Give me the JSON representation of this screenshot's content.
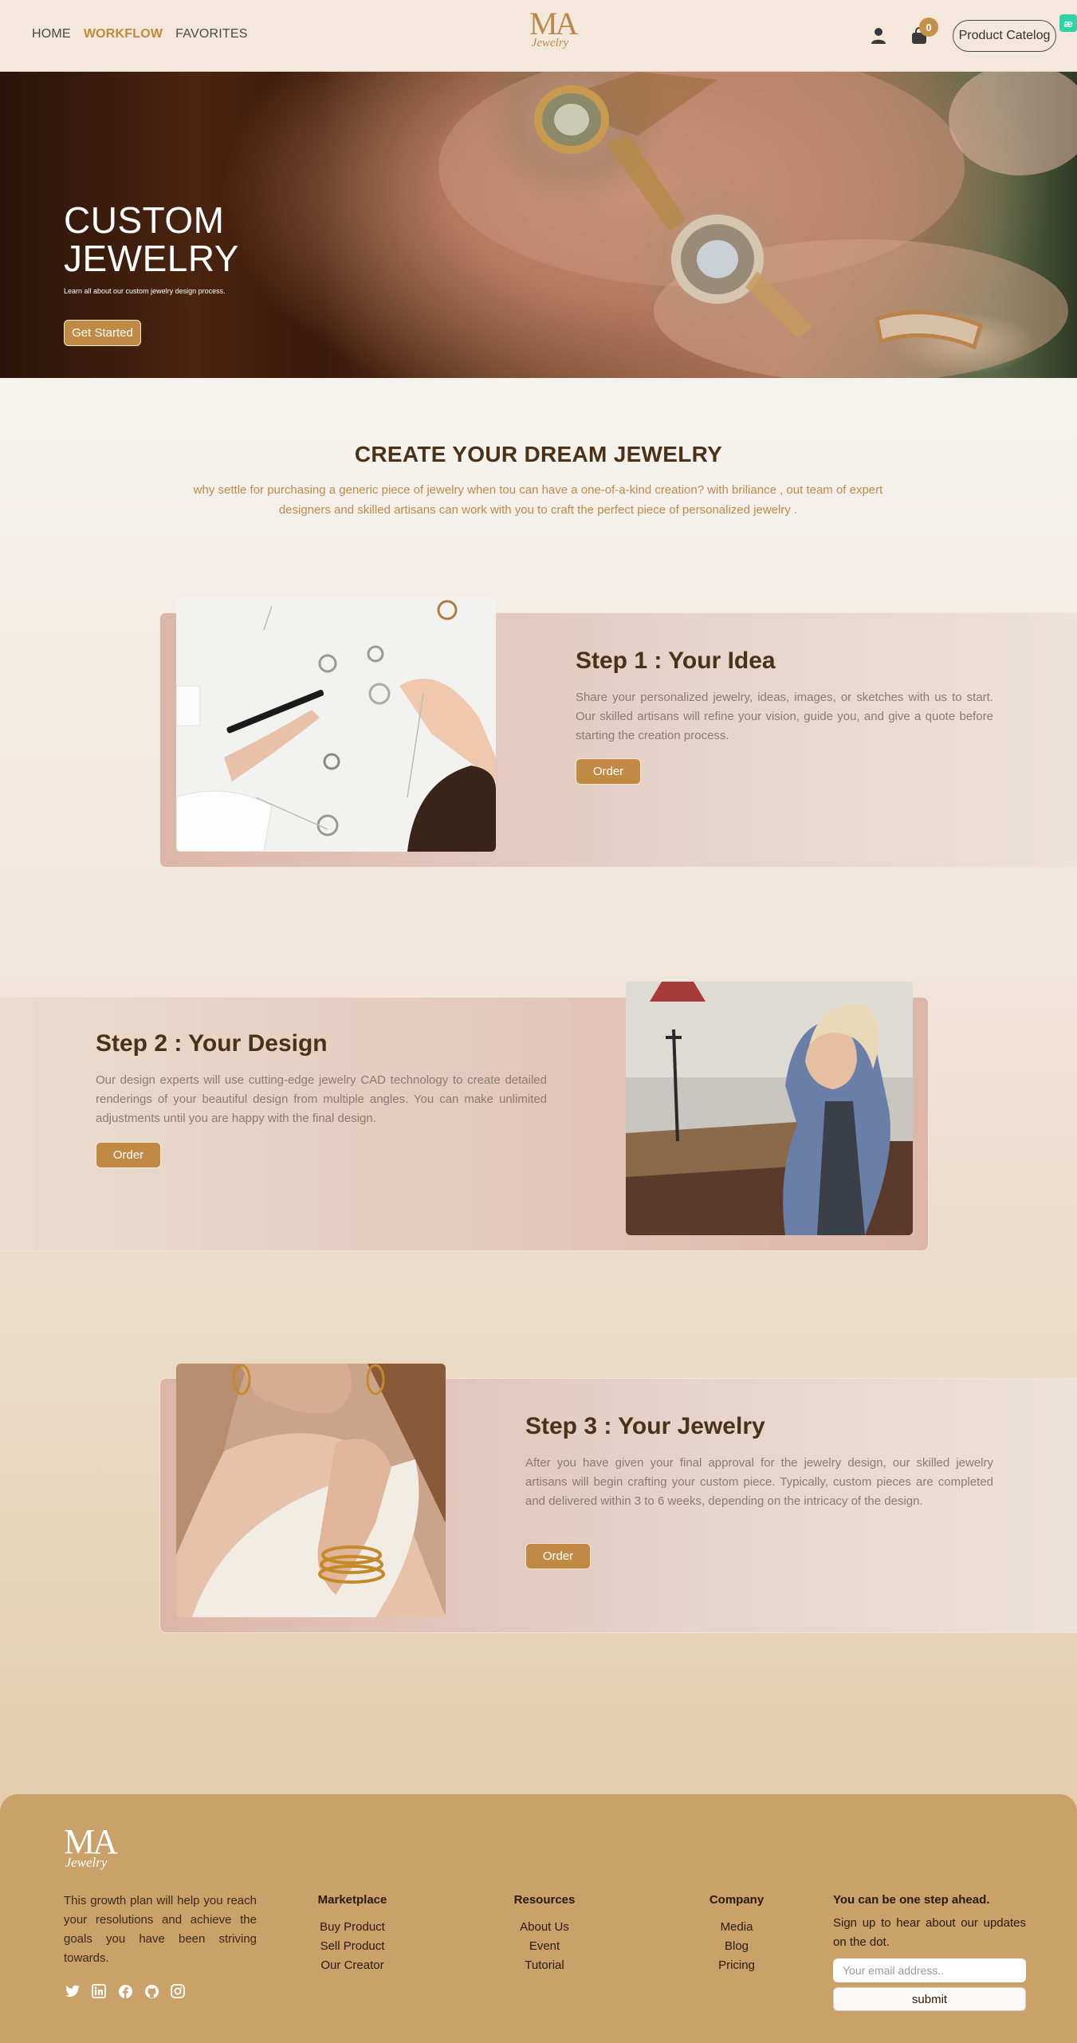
{
  "nav": {
    "links": [
      "HOME",
      "WORKFLOW",
      "FAVORITES"
    ],
    "active": "WORKFLOW",
    "logo_main": "MA",
    "logo_sub": "Jewelry",
    "cart_count": "0",
    "catalog_label": "Product Catelog",
    "ext_badge": "æ"
  },
  "hero": {
    "title_line1": "CUSTOM",
    "title_line2": "JEWELRY",
    "subtitle": "Learn all about our custom jewelry design process.",
    "button_label": "Get Started"
  },
  "intro": {
    "title": "CREATE YOUR DREAM JEWELRY",
    "text": "why settle for purchasing a generic piece of jewelry when tou can have a one-of-a-kind creation? with briliance , out team of expert designers and skilled artisans can work with you to craft the perfect piece of personalized jewelry ."
  },
  "steps": [
    {
      "title": "Step 1 : Your Idea",
      "text": "Share your personalized jewelry, ideas, images, or sketches with us to start. Our skilled artisans will refine your vision, guide you, and give a quote before starting the creation process.",
      "button": "Order"
    },
    {
      "title": "Step 2 : Your Design",
      "text": "Our design experts will use cutting-edge jewelry CAD technology to create detailed renderings of your beautiful design from multiple angles. You can make unlimited adjustments until you are happy with the final design.",
      "button": "Order"
    },
    {
      "title": "Step 3 : Your Jewelry",
      "text": "After you have given your final approval for the jewelry design, our skilled jewelry artisans will begin crafting your custom piece. Typically, custom pieces are completed and delivered within 3 to 6 weeks, depending on the intricacy of the design.",
      "button": "Order"
    }
  ],
  "footer": {
    "logo_main": "MA",
    "logo_sub": "Jewelry",
    "about": "This growth plan will help you reach your resolutions and achieve the goals you have been striving towards.",
    "social_icons": [
      "twitter-icon",
      "linkedin-icon",
      "facebook-icon",
      "github-icon",
      "instagram-icon"
    ],
    "columns": [
      {
        "title": "Marketplace",
        "items": [
          "Buy Product",
          "Sell Product",
          "Our Creator"
        ]
      },
      {
        "title": "Resources",
        "items": [
          "About Us",
          "Event",
          "Tutorial"
        ]
      },
      {
        "title": "Company",
        "items": [
          "Media",
          "Blog",
          "Pricing"
        ]
      }
    ],
    "newsletter_title": "You can be one step ahead.",
    "newsletter_text": "Sign up to hear about our updates on the dot.",
    "email_placeholder": "Your email address..",
    "submit_label": "submit"
  },
  "colors": {
    "accent": "#c08a45",
    "footer_bg": "#c9a169",
    "heading": "#4a3218"
  }
}
